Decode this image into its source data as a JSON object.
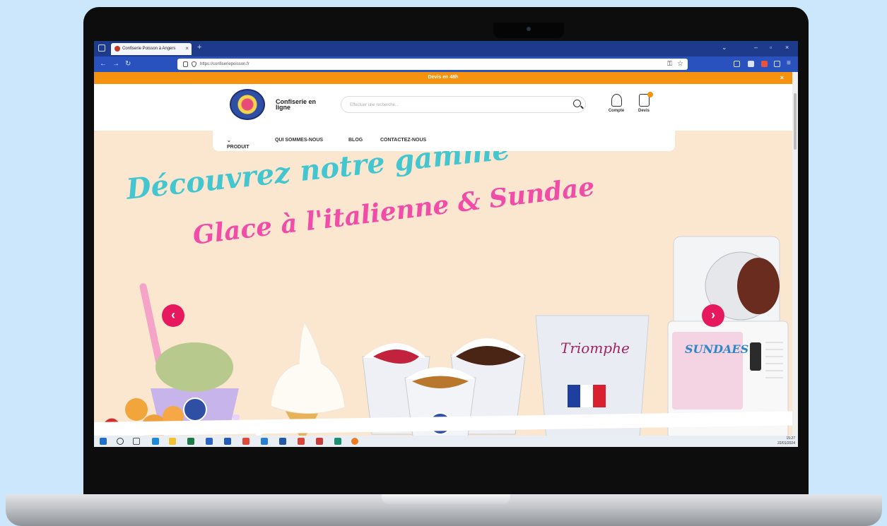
{
  "browser": {
    "tab_title": "Confiserie Poisson à Angers",
    "url": "https://confiseriepoisson.fr"
  },
  "site": {
    "promo_text": "Devis en 48h",
    "brand_name": "Confiserie en ligne",
    "search_placeholder": "Effectuer une recherche...",
    "account_label": "Compte",
    "quote_label": "Devis",
    "menu": [
      "PRODUIT",
      "QUI SOMMES-NOUS",
      "BLOG",
      "CONTACTEZ-NOUS"
    ]
  },
  "hero": {
    "headline1": "Découvrez notre gamme",
    "headline2": "Glace à l'italienne & Sundae",
    "pouch_brand": "Triomphe",
    "machine_label": "SUNDAES"
  },
  "taskbar": {
    "time": "15:27",
    "date": "22/01/2024"
  },
  "colors": {
    "promo": "#f59210",
    "arrow": "#e8185f",
    "headline1": "#43c6cf",
    "headline2": "#f04ca8",
    "hero_bg": "#fbe6cf"
  }
}
